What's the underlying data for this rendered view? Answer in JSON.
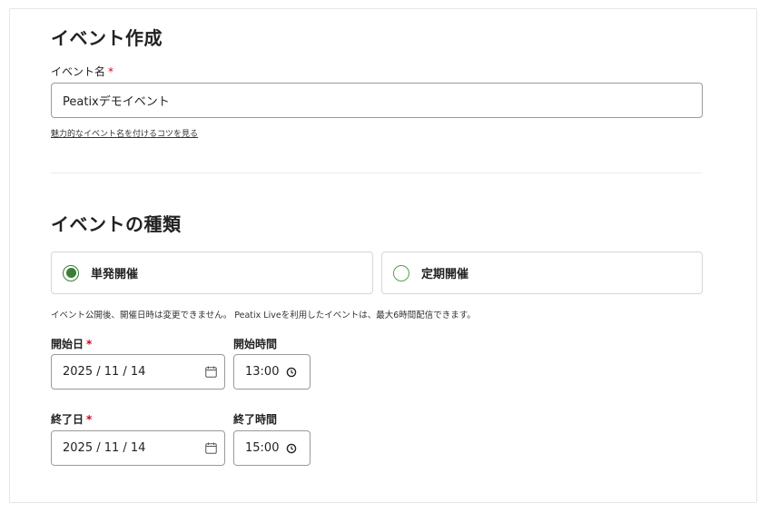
{
  "section_create": {
    "title": "イベント作成",
    "name_label": "イベント名",
    "required_mark": "*",
    "name_value": "Peatixデモイベント",
    "tips_link": "魅力的なイベント名を付けるコツを見る"
  },
  "section_type": {
    "title": "イベントの種類",
    "option_single": "単発開催",
    "option_recurring": "定期開催",
    "selected": "単発開催",
    "note": "イベント公開後、開催日時は変更できません。 Peatix Liveを利用したイベントは、最大6時間配信できます。"
  },
  "schedule": {
    "start_date_label": "開始日",
    "start_time_label": "開始時間",
    "start_date": "2025 / 11 / 14",
    "start_time": "13:00",
    "end_date_label": "終了日",
    "end_time_label": "終了時間",
    "end_date": "2025 / 11 / 14",
    "end_time": "15:00",
    "required_mark": "*"
  },
  "icons": {
    "date": "calendar-icon",
    "time": "clock-icon"
  },
  "colors": {
    "accent_green": "#3a7f35",
    "required_red": "#d0021b"
  }
}
